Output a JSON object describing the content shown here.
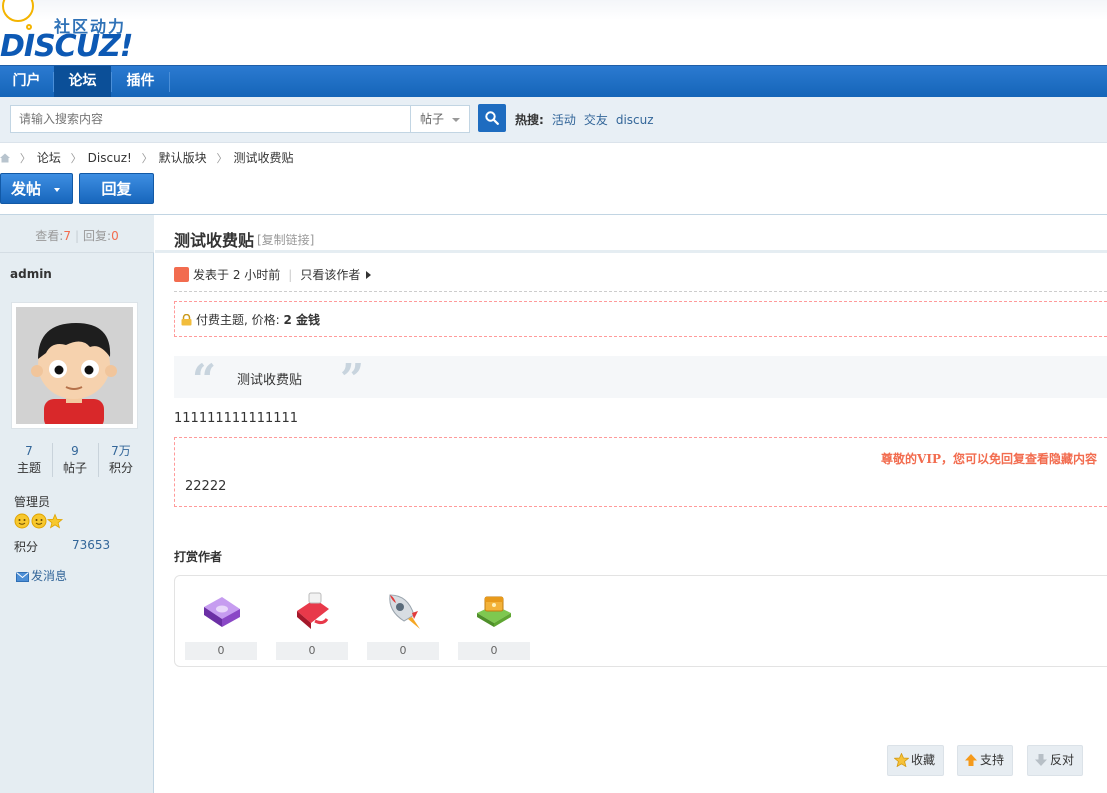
{
  "header": {
    "logo_cn": "社区动力",
    "logo_en": "DISCUZ!"
  },
  "nav": {
    "items": [
      {
        "label": "门户"
      },
      {
        "label": "论坛"
      },
      {
        "label": "插件"
      }
    ],
    "active_index": 1
  },
  "search": {
    "placeholder": "请输入搜索内容",
    "type": "帖子",
    "hot_label": "热搜:",
    "hot_terms": [
      "活动",
      "交友",
      "discuz"
    ]
  },
  "breadcrumb": {
    "items": [
      "论坛",
      "Discuz!",
      "默认版块",
      "测试收费贴"
    ]
  },
  "actions": {
    "post_label": "发帖",
    "reply_label": "回复"
  },
  "thread_stats": {
    "views_label": "查看:",
    "views": "7",
    "replies_label": "回复:",
    "replies": "0"
  },
  "author": {
    "name": "admin",
    "stats": [
      {
        "value": "7",
        "label": "主题"
      },
      {
        "value": "9",
        "label": "帖子"
      },
      {
        "value": "7万",
        "label": "积分"
      }
    ],
    "group": "管理员",
    "points_label": "积分",
    "points": "73653",
    "message_label": "发消息"
  },
  "post": {
    "title": "测试收费贴",
    "copy_link": "[复制链接]",
    "posted": "发表于 2 小时前",
    "only_author": "只看该作者",
    "pay_prefix": "付费主题, 价格: ",
    "pay_value": "2 金钱",
    "quote": "测试收费贴",
    "body": "111111111111111",
    "vip_notice": "尊敬的VIP，您可以免回复查看隐藏内容",
    "hidden_text": "22222"
  },
  "reward": {
    "title": "打赏作者",
    "gifts": [
      {
        "icon": "book-gift-icon",
        "count": "0"
      },
      {
        "icon": "flower-gift-icon",
        "count": "0"
      },
      {
        "icon": "rocket-gift-icon",
        "count": "0"
      },
      {
        "icon": "treasure-gift-icon",
        "count": "0"
      }
    ]
  },
  "bottom_actions": {
    "favorite": "收藏",
    "support": "支持",
    "oppose": "反对"
  },
  "colors": {
    "nav_blue": "#1565b8",
    "accent_red": "#f26c4f",
    "link_blue": "#336699",
    "sidebar_bg": "#e5edf2"
  }
}
